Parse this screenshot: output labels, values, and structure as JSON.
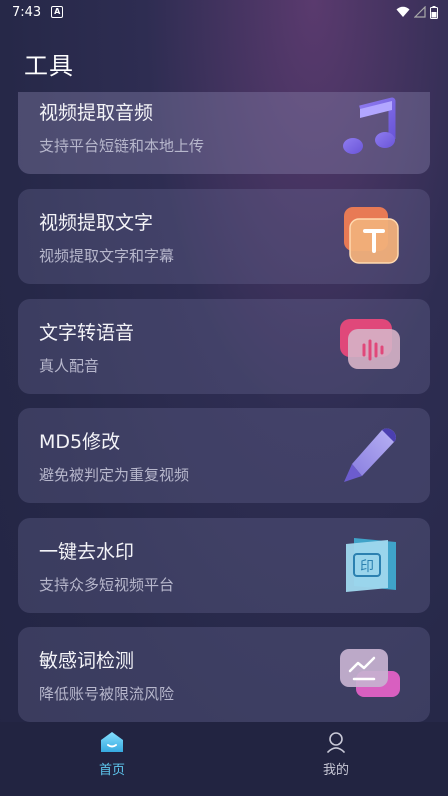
{
  "status_bar": {
    "time": "7:43",
    "notif_icon": "a-icon"
  },
  "header": {
    "title": "工具"
  },
  "tools": [
    {
      "title": "视频提取音频",
      "subtitle": "支持平台短链和本地上传",
      "icon": "music-note-icon"
    },
    {
      "title": "视频提取文字",
      "subtitle": "视频提取文字和字幕",
      "icon": "text-t-icon"
    },
    {
      "title": "文字转语音",
      "subtitle": "真人配音",
      "icon": "voice-wave-icon"
    },
    {
      "title": "MD5修改",
      "subtitle": "避免被判定为重复视频",
      "icon": "pen-icon"
    },
    {
      "title": "一键去水印",
      "subtitle": "支持众多短视频平台",
      "icon": "stamp-icon"
    },
    {
      "title": "敏感词检测",
      "subtitle": "降低账号被限流风险",
      "icon": "chart-icon"
    }
  ],
  "bottom_nav": {
    "home_label": "首页",
    "mine_label": "我的"
  },
  "colors": {
    "accent": "#5fc8f0",
    "background": "#262848"
  }
}
